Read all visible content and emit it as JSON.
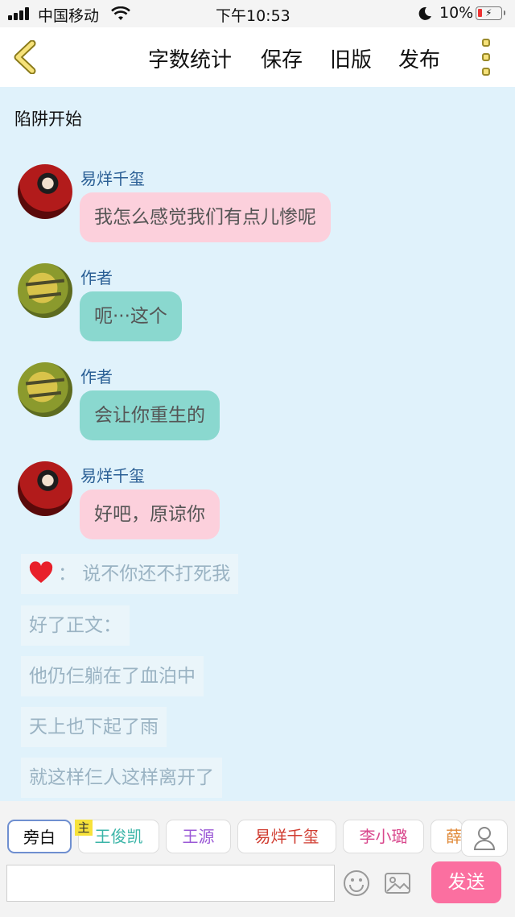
{
  "status_bar": {
    "carrier": "中国移动",
    "time": "下午10:53",
    "battery": "10%"
  },
  "header": {
    "word_count": "字数统计",
    "save": "保存",
    "old_version": "旧版",
    "publish": "发布"
  },
  "story_title": "陷阱开始",
  "messages": [
    {
      "name": "易烊千玺",
      "text": "我怎么感觉我们有点儿惨呢"
    },
    {
      "name": "作者",
      "text": "呃···这个"
    },
    {
      "name": "作者",
      "text": "会让你重生的"
    },
    {
      "name": "易烊千玺",
      "text": "好吧，原谅你"
    }
  ],
  "narration": [
    "：  说不你还不打死我",
    "好了正文：",
    "他仍仨躺在了血泊中",
    "天上也下起了雨",
    "就这样仨人这样离开了"
  ],
  "characters": [
    {
      "label": "旁白",
      "color": "#111111"
    },
    {
      "label": "王俊凯",
      "color": "#3bb5a8"
    },
    {
      "label": "王源",
      "color": "#9b59d6"
    },
    {
      "label": "易烊千玺",
      "color": "#d03b2f"
    },
    {
      "label": "李小璐",
      "color": "#d9488d"
    },
    {
      "label": "薛",
      "color": "#e08a3a"
    }
  ],
  "main_badge": "主",
  "send_label": "发送",
  "colors": {
    "background": "#e0f2fb",
    "pink_bubble": "#fcd0dc",
    "teal_bubble": "#8ad8cf",
    "send_button": "#fb6fa0"
  }
}
